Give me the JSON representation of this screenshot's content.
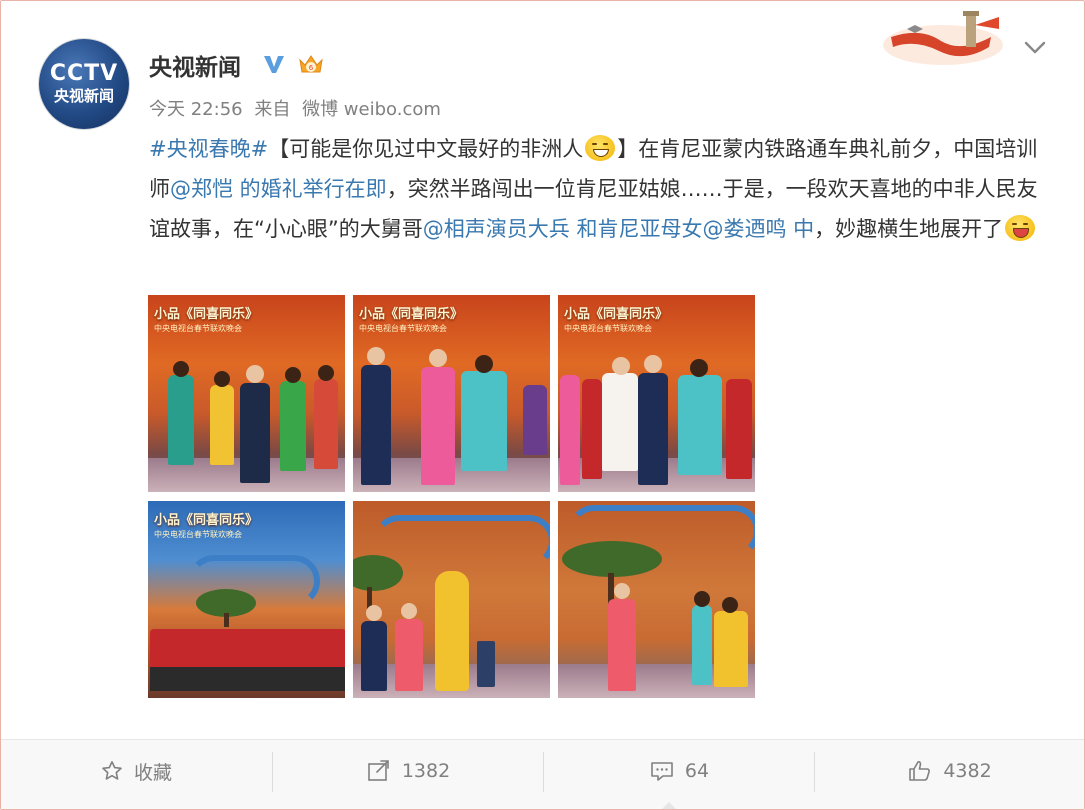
{
  "post": {
    "author": "央视新闻",
    "avatar_logo": "CCTV",
    "avatar_sub": "央视新闻",
    "meta_time": "今天 22:56",
    "meta_from": "来自",
    "meta_source": "微博 weibo.com",
    "text": {
      "hashtag": "#央视春晚#",
      "t1": "【可能是你见过中文最好的非洲人",
      "t2": "】在肯尼亚蒙内铁路通车典礼前夕，中国培训师",
      "mention1": "@郑恺 的婚礼举行在即",
      "t3": "，突然半路闯出一位肯尼亚姑娘……于是，一段欢天喜地的中非人民友谊故事，在“小心眼”的大舅哥",
      "mention2": "@相声演员大兵 和肯尼亚母女@娄迺鸣 中",
      "t4": "，妙趣横生地展开了"
    },
    "photos": [
      {
        "title": "小品《同喜同乐》",
        "subtitle": "中央电视台春节联欢晚会"
      },
      {
        "title": "小品《同喜同乐》",
        "subtitle": "中央电视台春节联欢晚会"
      },
      {
        "title": "小品《同喜同乐》",
        "subtitle": "中央电视台春节联欢晚会"
      },
      {
        "title": "小品《同喜同乐》",
        "subtitle": "中央电视台春节联欢晚会"
      },
      {
        "title": "",
        "subtitle": ""
      },
      {
        "title": "",
        "subtitle": ""
      }
    ]
  },
  "actions": {
    "favorite": "收藏",
    "repost": "1382",
    "comment": "64",
    "like": "4382"
  },
  "colors": {
    "link": "#3a78b0",
    "border": "#e9b3a8",
    "verified": "#5b9ee0"
  }
}
